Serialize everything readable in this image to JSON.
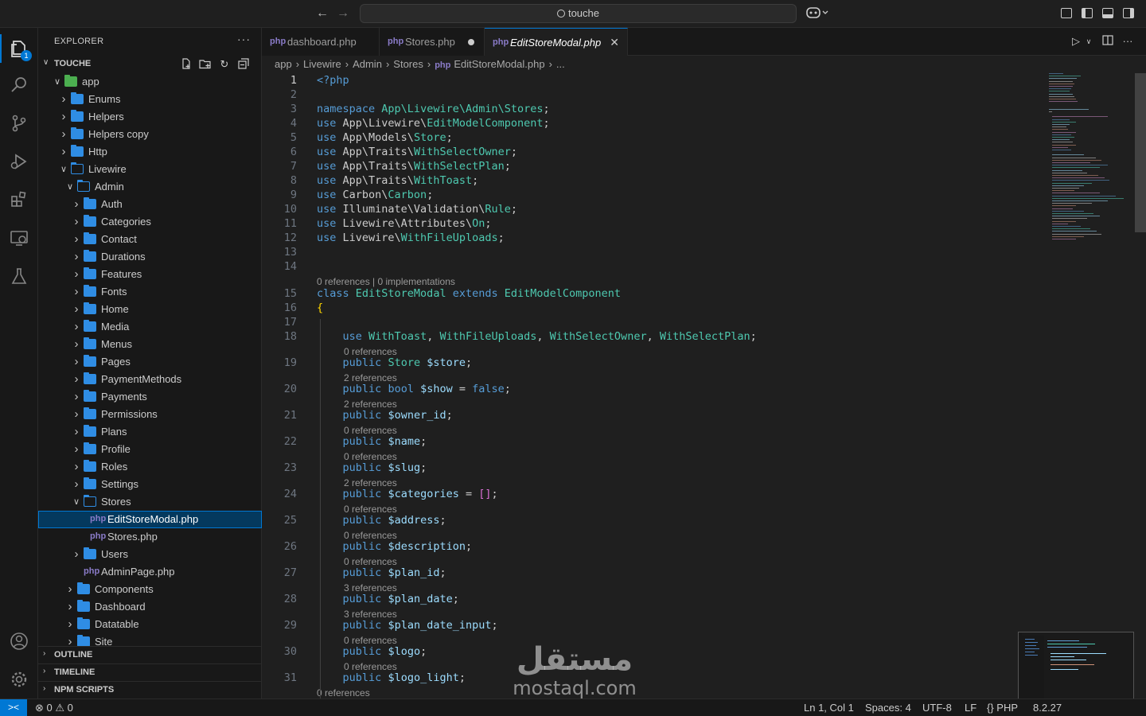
{
  "titlebar": {
    "search_text": "touche"
  },
  "activity": {
    "explorer_badge": "1"
  },
  "sidebar": {
    "title": "EXPLORER",
    "more": "···",
    "workspace": "TOUCHE",
    "tree": [
      {
        "label": "app",
        "depth": 1,
        "type": "folder-app",
        "open": true
      },
      {
        "label": "Enums",
        "depth": 2,
        "type": "folder",
        "open": false
      },
      {
        "label": "Helpers",
        "depth": 2,
        "type": "folder",
        "open": false
      },
      {
        "label": "Helpers copy",
        "depth": 2,
        "type": "folder",
        "open": false
      },
      {
        "label": "Http",
        "depth": 2,
        "type": "folder",
        "open": false
      },
      {
        "label": "Livewire",
        "depth": 2,
        "type": "folder",
        "open": true
      },
      {
        "label": "Admin",
        "depth": 3,
        "type": "folder",
        "open": true
      },
      {
        "label": "Auth",
        "depth": 4,
        "type": "folder",
        "open": false
      },
      {
        "label": "Categories",
        "depth": 4,
        "type": "folder",
        "open": false
      },
      {
        "label": "Contact",
        "depth": 4,
        "type": "folder",
        "open": false
      },
      {
        "label": "Durations",
        "depth": 4,
        "type": "folder",
        "open": false
      },
      {
        "label": "Features",
        "depth": 4,
        "type": "folder",
        "open": false
      },
      {
        "label": "Fonts",
        "depth": 4,
        "type": "folder",
        "open": false
      },
      {
        "label": "Home",
        "depth": 4,
        "type": "folder",
        "open": false
      },
      {
        "label": "Media",
        "depth": 4,
        "type": "folder",
        "open": false
      },
      {
        "label": "Menus",
        "depth": 4,
        "type": "folder",
        "open": false
      },
      {
        "label": "Pages",
        "depth": 4,
        "type": "folder",
        "open": false
      },
      {
        "label": "PaymentMethods",
        "depth": 4,
        "type": "folder",
        "open": false
      },
      {
        "label": "Payments",
        "depth": 4,
        "type": "folder",
        "open": false
      },
      {
        "label": "Permissions",
        "depth": 4,
        "type": "folder",
        "open": false
      },
      {
        "label": "Plans",
        "depth": 4,
        "type": "folder",
        "open": false
      },
      {
        "label": "Profile",
        "depth": 4,
        "type": "folder",
        "open": false
      },
      {
        "label": "Roles",
        "depth": 4,
        "type": "folder",
        "open": false
      },
      {
        "label": "Settings",
        "depth": 4,
        "type": "folder",
        "open": false
      },
      {
        "label": "Stores",
        "depth": 4,
        "type": "folder",
        "open": true
      },
      {
        "label": "EditStoreModal.php",
        "depth": 5,
        "type": "php",
        "selected": true
      },
      {
        "label": "Stores.php",
        "depth": 5,
        "type": "php"
      },
      {
        "label": "Users",
        "depth": 4,
        "type": "folder",
        "open": false
      },
      {
        "label": "AdminPage.php",
        "depth": 4,
        "type": "php"
      },
      {
        "label": "Components",
        "depth": 3,
        "type": "folder",
        "open": false
      },
      {
        "label": "Dashboard",
        "depth": 3,
        "type": "folder",
        "open": false
      },
      {
        "label": "Datatable",
        "depth": 3,
        "type": "folder",
        "open": false
      },
      {
        "label": "Site",
        "depth": 3,
        "type": "folder",
        "open": false
      }
    ],
    "sections": [
      "OUTLINE",
      "TIMELINE",
      "NPM SCRIPTS"
    ]
  },
  "tabs": [
    {
      "label": "dashboard.php",
      "state": "normal"
    },
    {
      "label": "Stores.php",
      "state": "dirty"
    },
    {
      "label": "EditStoreModal.php",
      "state": "active"
    }
  ],
  "breadcrumb": [
    "app",
    "Livewire",
    "Admin",
    "Stores",
    "EditStoreModal.php",
    "..."
  ],
  "editor": {
    "lines": [
      {
        "n": "1",
        "html": "<span class=\"ptag\">&lt;?php</span>"
      },
      {
        "n": "2",
        "html": ""
      },
      {
        "n": "3",
        "html": "<span class=\"kw\">namespace</span> <span class=\"cls\">App\\Livewire\\Admin\\Stores</span>;"
      },
      {
        "n": "4",
        "html": "<span class=\"kw\">use</span> App\\Livewire\\<span class=\"cls\">EditModelComponent</span>;"
      },
      {
        "n": "5",
        "html": "<span class=\"kw\">use</span> App\\Models\\<span class=\"cls\">Store</span>;"
      },
      {
        "n": "6",
        "html": "<span class=\"kw\">use</span> App\\Traits\\<span class=\"cls\">WithSelectOwner</span>;"
      },
      {
        "n": "7",
        "html": "<span class=\"kw\">use</span> App\\Traits\\<span class=\"cls\">WithSelectPlan</span>;"
      },
      {
        "n": "8",
        "html": "<span class=\"kw\">use</span> App\\Traits\\<span class=\"cls\">WithToast</span>;"
      },
      {
        "n": "9",
        "html": "<span class=\"kw\">use</span> Carbon\\<span class=\"cls\">Carbon</span>;"
      },
      {
        "n": "10",
        "html": "<span class=\"kw\">use</span> Illuminate\\Validation\\<span class=\"cls\">Rule</span>;"
      },
      {
        "n": "11",
        "html": "<span class=\"kw\">use</span> Livewire\\Attributes\\<span class=\"cls\">On</span>;"
      },
      {
        "n": "12",
        "html": "<span class=\"kw\">use</span> Livewire\\<span class=\"cls\">WithFileUploads</span>;"
      },
      {
        "n": "13",
        "html": ""
      },
      {
        "n": "14",
        "html": ""
      },
      {
        "n": "15",
        "html": "<span class=\"kw\">class</span> <span class=\"cls\">EditStoreModal</span> <span class=\"kw\">extends</span> <span class=\"cls\">EditModelComponent</span>",
        "lens": "0 references | 0 implementations"
      },
      {
        "n": "16",
        "html": "<span class=\"brk\">{</span>"
      },
      {
        "n": "17",
        "html": ""
      },
      {
        "n": "18",
        "html": "    <span class=\"kw\">use</span> <span class=\"cls\">WithToast</span>, <span class=\"cls\">WithFileUploads</span>, <span class=\"cls\">WithSelectOwner</span>, <span class=\"cls\">WithSelectPlan</span>;"
      },
      {
        "n": "19",
        "html": "    <span class=\"kw\">public</span> <span class=\"cls\">Store</span> <span class=\"var\">$store</span>;",
        "lens": "0 references"
      },
      {
        "n": "20",
        "html": "    <span class=\"kw\">public</span> <span class=\"kw\">bool</span> <span class=\"var\">$show</span> = <span class=\"kw\">false</span>;",
        "lens": "2 references"
      },
      {
        "n": "21",
        "html": "    <span class=\"kw\">public</span> <span class=\"var\">$owner_id</span>;",
        "lens": "2 references"
      },
      {
        "n": "22",
        "html": "    <span class=\"kw\">public</span> <span class=\"var\">$name</span>;",
        "lens": "0 references"
      },
      {
        "n": "23",
        "html": "    <span class=\"kw\">public</span> <span class=\"var\">$slug</span>;",
        "lens": "0 references"
      },
      {
        "n": "24",
        "html": "    <span class=\"kw\">public</span> <span class=\"var\">$categories</span> = <span class=\"brk2\">[]</span>;",
        "lens": "2 references"
      },
      {
        "n": "25",
        "html": "    <span class=\"kw\">public</span> <span class=\"var\">$address</span>;",
        "lens": "0 references"
      },
      {
        "n": "26",
        "html": "    <span class=\"kw\">public</span> <span class=\"var\">$description</span>;",
        "lens": "0 references"
      },
      {
        "n": "27",
        "html": "    <span class=\"kw\">public</span> <span class=\"var\">$plan_id</span>;",
        "lens": "0 references"
      },
      {
        "n": "28",
        "html": "    <span class=\"kw\">public</span> <span class=\"var\">$plan_date</span>;",
        "lens": "3 references"
      },
      {
        "n": "29",
        "html": "    <span class=\"kw\">public</span> <span class=\"var\">$plan_date_input</span>;",
        "lens": "3 references"
      },
      {
        "n": "30",
        "html": "    <span class=\"kw\">public</span> <span class=\"var\">$logo</span>;",
        "lens": "0 references"
      },
      {
        "n": "31",
        "html": "    <span class=\"kw\">public</span> <span class=\"var\">$logo_light</span>;",
        "lens": "0 references"
      },
      {
        "n": "",
        "html": "",
        "lens": "0 references"
      }
    ]
  },
  "watermark": {
    "arabic": "مستقل",
    "latin": "mostaql.com"
  },
  "statusbar": {
    "remote": "><",
    "problems": "⊗ 0 ⚠ 0",
    "position": "Ln 1, Col 1",
    "spaces": "Spaces: 4",
    "encoding": "UTF-8",
    "eol": "LF",
    "language": "{} PHP",
    "version": "8.2.27"
  },
  "colors": {
    "accent": "#0078d4",
    "folder": "#2f8de4",
    "php": "#8a7bc8"
  }
}
